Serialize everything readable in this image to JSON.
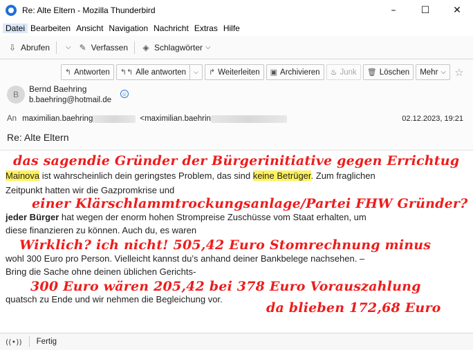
{
  "window": {
    "title": "Re: Alte Eltern - Mozilla Thunderbird",
    "controls": [
      "–",
      "☐",
      "✕"
    ]
  },
  "menu": [
    {
      "label": "Datei",
      "active": true
    },
    {
      "label": "Bearbeiten"
    },
    {
      "label": "Ansicht"
    },
    {
      "label": "Navigation"
    },
    {
      "label": "Nachricht"
    },
    {
      "label": "Extras"
    },
    {
      "label": "Hilfe"
    }
  ],
  "toolbar": {
    "fetch_label": "Abrufen",
    "compose_label": "Verfassen",
    "tags_label": "Schlagwörter"
  },
  "actions": {
    "reply": "Antworten",
    "reply_all": "Alle antworten",
    "forward": "Weiterleiten",
    "archive": "Archivieren",
    "junk": "Junk",
    "delete": "Löschen",
    "more": "Mehr"
  },
  "message": {
    "avatar_letter": "B",
    "sender_name": "Bernd Baehring",
    "sender_email": "b.baehring@hotmail.de",
    "to_label": "An",
    "to_part1": "maximilian.baehring",
    "to_part2": "<maximilian.baehrin",
    "date": "02.12.2023, 19:21",
    "subject": "Re: Alte Eltern",
    "body": {
      "l1_hl1": "Mainova",
      "l1_mid": " ist wahrscheinlich dein geringstes Problem, das sind ",
      "l1_hl2": "keine Betrüger",
      "l1_end": ". Zum fraglichen",
      "l2": "Zeitpunkt hatten wir die Gazpromkrise und",
      "l3_bold": "jeder Bürger",
      "l3_rest": " hat wegen der enorm hohen Strompreise Zuschüsse vom Staat erhalten, um",
      "l4": "diese finanzieren zu können. Auch du, es waren",
      "l5": "wohl 300 Euro pro Person. Vielleicht kannst du’s anhand deiner Bankbelege nachsehen. –",
      "l6": "Bring die Sache ohne deinen üblichen Gerichts-",
      "l7": "quatsch zu Ende und wir nehmen die Begleichung vor."
    }
  },
  "annotations": {
    "a1": "das sagendie Gründer der Bürgerinitiative gegen Errichtug",
    "a2": "einer Klärschlammtrockungsanlage/Partei FHW Gründer?",
    "a3": "Wirklich? ich nicht! 505,42 Euro Stomrechnung minus",
    "a4": "300 Euro wären 205,42 bei 378 Euro Vorauszahlung",
    "a5": "da blieben 172,68 Euro",
    "color": "#ee1c1c"
  },
  "status": {
    "text": "Fertig"
  }
}
